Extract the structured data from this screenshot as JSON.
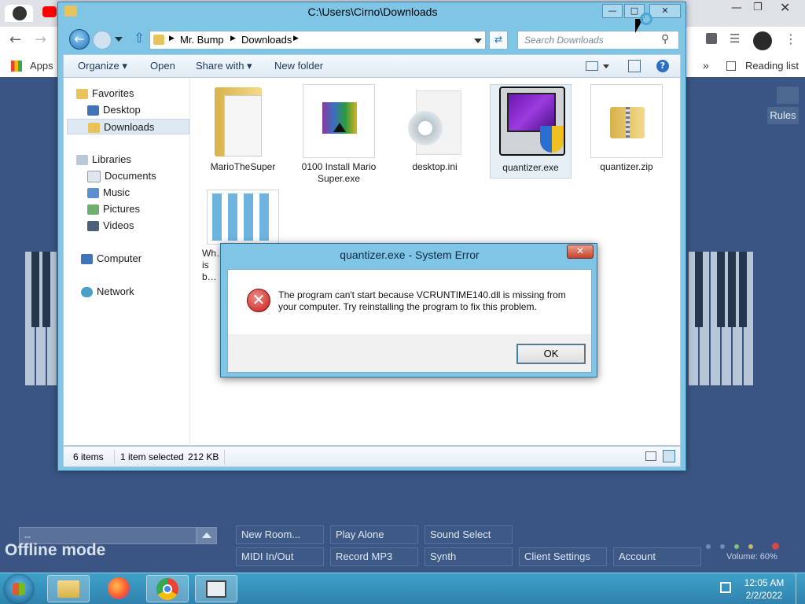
{
  "browser": {
    "bookmarks": {
      "apps": "Apps",
      "reading_list": "Reading list"
    }
  },
  "page": {
    "rules_label": "Rules",
    "offline_mode": "Offline mode",
    "chat_placeholder": "--",
    "buttons": {
      "new_room": "New Room...",
      "play_alone": "Play Alone",
      "sound_select": "Sound Select",
      "midi": "MIDI In/Out",
      "record": "Record MP3",
      "synth": "Synth",
      "client_settings": "Client Settings",
      "account": "Account"
    },
    "volume": "Volume: 60%"
  },
  "explorer": {
    "title": "C:\\Users\\Cirno\\Downloads",
    "breadcrumb": [
      "Mr. Bump",
      "Downloads"
    ],
    "search_placeholder": "Search Downloads",
    "toolbar": {
      "organize": "Organize",
      "open": "Open",
      "share_with": "Share with",
      "new_folder": "New folder"
    },
    "nav": {
      "favorites": "Favorites",
      "desktop": "Desktop",
      "downloads": "Downloads",
      "libraries": "Libraries",
      "documents": "Documents",
      "music": "Music",
      "pictures": "Pictures",
      "videos": "Videos",
      "computer": "Computer",
      "network": "Network"
    },
    "files": [
      {
        "name": "MarioTheSuper"
      },
      {
        "name": "0100 Install Mario Super.exe"
      },
      {
        "name": "desktop.ini"
      },
      {
        "name": "quantizer.exe"
      },
      {
        "name": "quantizer.zip"
      },
      {
        "name": "Wh… is b…"
      }
    ],
    "status": {
      "items": "6 items",
      "selected": "1 item selected",
      "size": "212 KB"
    }
  },
  "dialog": {
    "title": "quantizer.exe - System Error",
    "message": "The program can't start because VCRUNTIME140.dll is missing from your computer. Try reinstalling the program to fix this problem.",
    "ok": "OK"
  },
  "taskbar": {
    "time": "12:05 AM",
    "date": "2/2/2022"
  }
}
